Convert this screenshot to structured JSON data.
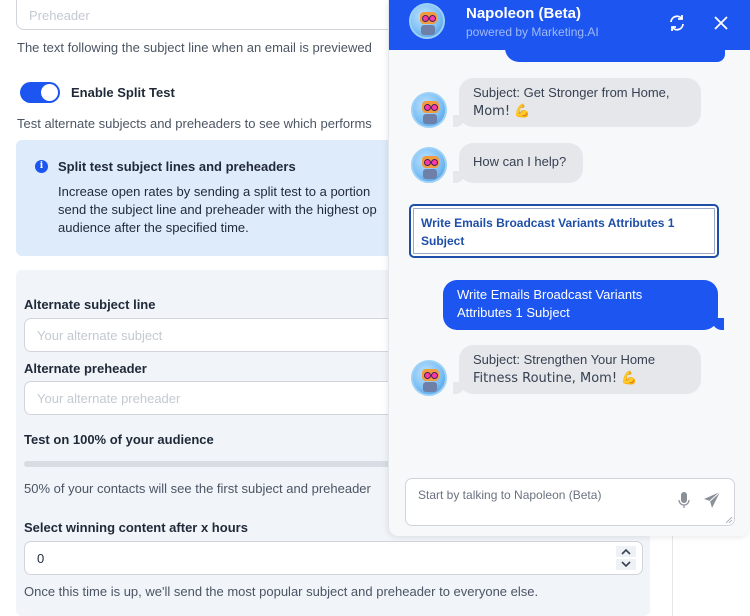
{
  "form": {
    "preheader_placeholder": "Preheader",
    "preheader_help": "The text following the subject line when an email is previewed",
    "split_test_toggle": {
      "label": "Enable Split Test",
      "enabled": true
    },
    "split_test_help": "Test alternate subjects and preheaders to see which performs",
    "info": {
      "icon": "info-icon",
      "title": "Split test subject lines and preheaders",
      "body_lines": [
        "Increase open rates by sending a split test to a portion",
        "send the subject line and preheader with the highest op",
        "audience after the specified time."
      ]
    },
    "alternate_subject": {
      "label": "Alternate subject line",
      "placeholder": "Your alternate subject"
    },
    "alternate_preheader": {
      "label": "Alternate preheader",
      "placeholder": "Your alternate preheader"
    },
    "audience": {
      "label": "Test on 100% of your audience",
      "percent": 100,
      "help": "50% of your contacts will see the first subject and preheader"
    },
    "winning": {
      "label": "Select winning content after x hours",
      "value": "0",
      "help": "Once this time is up, we'll send the most popular subject and preheader to everyone else."
    }
  },
  "chat": {
    "title": "Napoleon (Beta)",
    "subtitle": "powered by Marketing.AI",
    "icons": {
      "refresh": "refresh-icon",
      "close": "close-icon",
      "mic": "microphone-icon",
      "send": "send-icon"
    },
    "messages": [
      {
        "from": "bot",
        "line1": "Subject: Get Stronger from Home,",
        "line2": "Mom! 💪"
      },
      {
        "from": "bot",
        "line1": "How can I help?"
      },
      {
        "from": "suggestion",
        "line1": "Write Emails Broadcast Variants Attributes 1",
        "line2": "Subject"
      },
      {
        "from": "user",
        "line1": "Write Emails Broadcast Variants",
        "line2": "Attributes 1 Subject"
      },
      {
        "from": "bot",
        "line1": "Subject: Strengthen Your Home",
        "line2": "Fitness Routine, Mom! 💪"
      }
    ],
    "input_placeholder": "Start by talking to Napoleon (Beta)"
  },
  "colors": {
    "accent": "#1d55f0",
    "info_bg": "#deebfa",
    "panel_bg": "#f1f4f9",
    "bot_bubble": "#e5e7eb",
    "suggestion_text": "#1e4fa8"
  }
}
